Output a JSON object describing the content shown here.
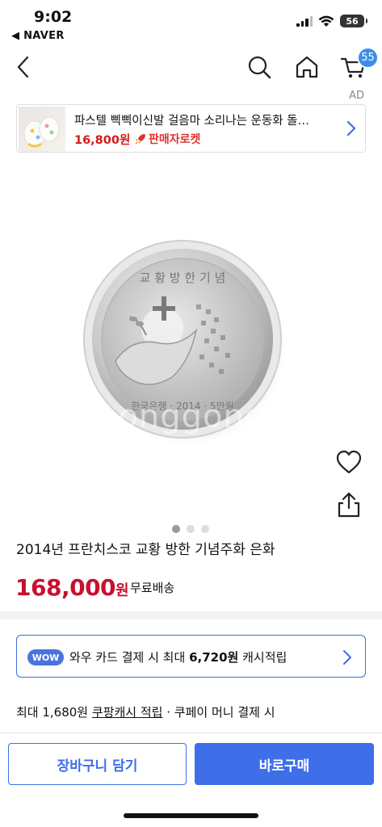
{
  "status_bar": {
    "time": "9:02",
    "back_app": "◀ NAVER",
    "battery": "56"
  },
  "header": {
    "cart_count": "55",
    "icons": [
      "back-chevron-icon",
      "search-icon",
      "home-icon",
      "cart-icon"
    ]
  },
  "ad": {
    "label": "AD",
    "title": "파스텔 삑삑이신발 걸음마 소리나는 운동화 돌…",
    "price": "16,800원",
    "rocket_label": "판매자로켓"
  },
  "product": {
    "watermark": "ponggong",
    "image_dots": 3,
    "active_dot": 0,
    "title": "2014년 프란치스코 교황 방한 기념주화 은화",
    "price_number": "168,000",
    "price_unit": "원",
    "shipping": "무료배송"
  },
  "wow": {
    "badge": "WOW",
    "text_prefix": "와우 카드 결제 시 최대",
    "amount": "6,720원",
    "text_suffix": "캐시적립"
  },
  "cash": {
    "prefix": "최대 1,680원",
    "link": "쿠팡캐시 적립",
    "suffix": "· 쿠페이 머니 결제 시"
  },
  "buttons": {
    "cart": "장바구니 담기",
    "buy": "바로구매"
  },
  "colors": {
    "accent": "#3e6ee8",
    "price_red": "#c8102e",
    "badge_blue": "#3b8ee8"
  }
}
